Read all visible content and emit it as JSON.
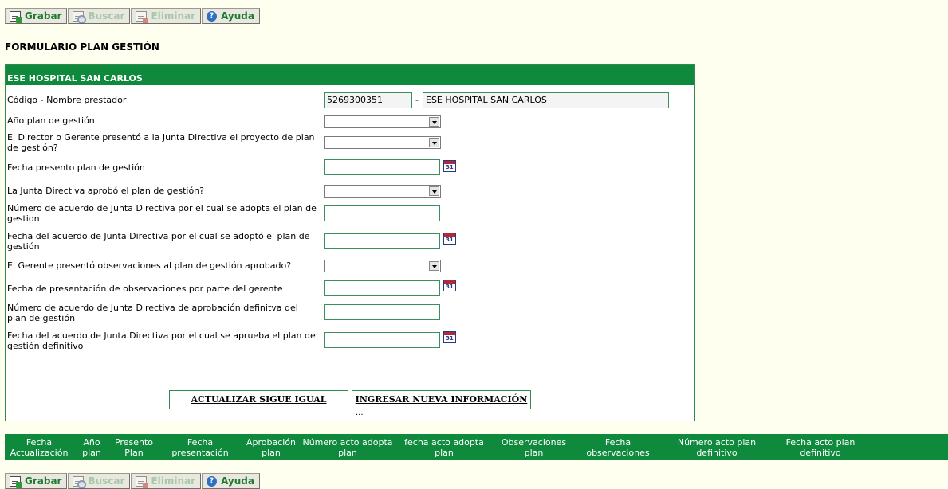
{
  "toolbar": {
    "save": "Grabar",
    "search": "Buscar",
    "delete": "Eliminar",
    "help": "Ayuda",
    "help_icon_glyph": "?"
  },
  "page_title": "FORMULARIO PLAN GESTIÓN",
  "form": {
    "header": "ESE HOSPITAL SAN CARLOS",
    "fields": {
      "provider_label": "Código - Nombre prestador",
      "provider_code": "5269300351",
      "provider_separator": "-",
      "provider_name": "ESE HOSPITAL SAN CARLOS",
      "plan_year_label": "Año plan de gestión",
      "director_presented_label": "El Director o Gerente presentó a la Junta Directiva el proyecto de plan de gestión?",
      "presented_date_label": "Fecha presento plan de gestión",
      "board_approved_label": "La Junta Directiva aprobó el plan de gestión?",
      "agreement_number_label": "Número de acuerdo de Junta Directiva por el cual se adopta el plan de gestion",
      "agreement_date_label": "Fecha del acuerdo de Junta Directiva por el cual se adoptó el plan de gestión",
      "observations_label": "El Gerente presentó observaciones al plan de gestión aprobado?",
      "observations_date_label": "Fecha de presentación de observaciones por parte del gerente",
      "final_agreement_number_label": "Número de acuerdo de Junta Directiva de aprobación definitva del plan de gestión",
      "final_agreement_date_label": "Fecha del acuerdo de Junta Directiva por el cual se aprueba el plan de gestión definitivo"
    },
    "buttons": {
      "update_same": "ACTUALIZAR SIGUE IGUAL",
      "enter_new": "INGRESAR NUEVA INFORMACIÓN"
    },
    "ellipsis": "..."
  },
  "grid": {
    "columns": [
      "Fecha Actualización",
      "Año plan",
      "Presento Plan",
      "Fecha presentación",
      "Aprobación plan",
      "Número acto adopta plan",
      "fecha acto adopta plan",
      "Observaciones plan",
      "Fecha observaciones",
      "Número acto plan definitivo",
      "Fecha acto plan definitivo"
    ]
  },
  "colors": {
    "header_green": "#0F8A3C",
    "page_bg": "#FFFFF0",
    "border_green": "#2E8B4E"
  }
}
